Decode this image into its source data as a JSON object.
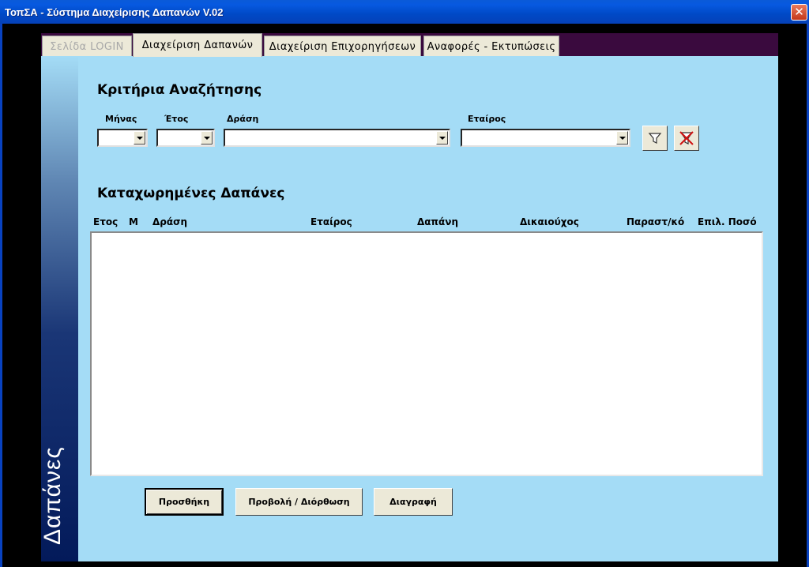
{
  "window": {
    "title": "ΤοπΣΑ - Σύστημα Διαχείρισης Δαπανών   V.02",
    "close_glyph": "✕"
  },
  "tabs": [
    {
      "label": "Σελίδα LOGIN",
      "state": "disabled"
    },
    {
      "label": "Διαχείριση Δαπανών",
      "state": "active"
    },
    {
      "label": "Διαχείριση Επιχορηγήσεων",
      "state": "normal"
    },
    {
      "label": "Αναφορές - Εκτυπώσεις",
      "state": "normal"
    }
  ],
  "sidebar": {
    "label": "Δαπάνες"
  },
  "search": {
    "title": "Κριτήρια Αναζήτησης",
    "month_label": "Μήνας",
    "year_label": "Έτος",
    "action_label": "Δράση",
    "partner_label": "Εταίρος",
    "month_value": "",
    "year_value": "",
    "action_value": "",
    "partner_value": "",
    "filter_icon": "filter-icon",
    "clear_filter_icon": "clear-filter-icon"
  },
  "expenses": {
    "title": "Καταχωρημένες Δαπάνες",
    "columns": [
      "Ετος",
      "Μ",
      "Δράση",
      "Εταίρος",
      "Δαπάνη",
      "Δικαιούχος",
      "Παραστ/κό",
      "Επιλ. Ποσό"
    ],
    "rows": []
  },
  "buttons": {
    "add": "Προσθήκη",
    "view_edit": "Προβολή / Διόρθωση",
    "delete": "Διαγραφή"
  },
  "colors": {
    "panel": "#a4dcf6",
    "tabstrip": "#3a0a3e",
    "titlebar": "#0049c6",
    "sidebar_dark": "#031a5a"
  }
}
